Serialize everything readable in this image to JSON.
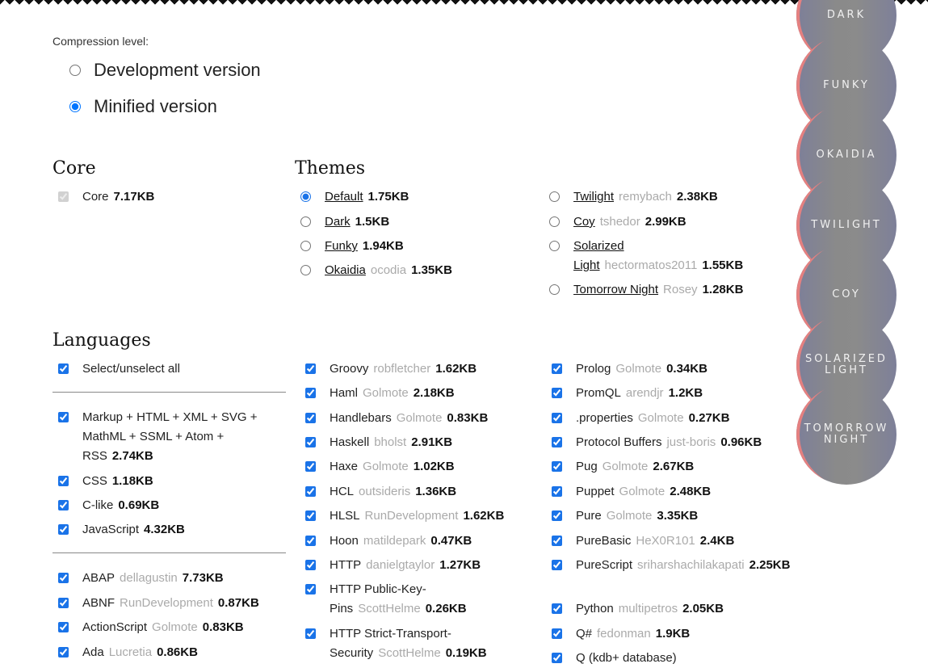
{
  "compression": {
    "label": "Compression level:",
    "options": [
      "Development version",
      "Minified version"
    ],
    "selected": "Minified version"
  },
  "core": {
    "heading": "Core",
    "item": {
      "name": "Core",
      "size": "7.17KB"
    }
  },
  "themes": {
    "heading": "Themes",
    "col1": [
      {
        "name": "Default",
        "owner": "",
        "size": "1.75KB"
      },
      {
        "name": "Dark",
        "owner": "",
        "size": "1.5KB"
      },
      {
        "name": "Funky",
        "owner": "",
        "size": "1.94KB"
      },
      {
        "name": "Okaidia",
        "owner": "ocodia",
        "size": "1.35KB"
      }
    ],
    "col2": [
      {
        "name": "Twilight",
        "owner": "remybach",
        "size": "2.38KB"
      },
      {
        "name": "Coy",
        "owner": "tshedor",
        "size": "2.99KB"
      },
      {
        "name": "Solarized Light",
        "owner": "hectormatos2011",
        "size": "1.55KB"
      },
      {
        "name": "Tomorrow Night",
        "owner": "Rosey",
        "size": "1.28KB"
      }
    ]
  },
  "languages": {
    "heading": "Languages",
    "select_all": "Select/unselect all",
    "col1": [
      {
        "name": "Markup + HTML + XML + SVG + MathML + SSML + Atom + RSS",
        "owner": "",
        "size": "2.74KB"
      },
      {
        "name": "CSS",
        "owner": "",
        "size": "1.18KB"
      },
      {
        "name": "C-like",
        "owner": "",
        "size": "0.69KB"
      },
      {
        "name": "JavaScript",
        "owner": "",
        "size": "4.32KB"
      },
      {
        "name": "ABAP",
        "owner": "dellagustin",
        "size": "7.73KB"
      },
      {
        "name": "ABNF",
        "owner": "RunDevelopment",
        "size": "0.87KB"
      },
      {
        "name": "ActionScript",
        "owner": "Golmote",
        "size": "0.83KB"
      },
      {
        "name": "Ada",
        "owner": "Lucretia",
        "size": "0.86KB"
      }
    ],
    "col2": [
      {
        "name": "Groovy",
        "owner": "robfletcher",
        "size": "1.62KB"
      },
      {
        "name": "Haml",
        "owner": "Golmote",
        "size": "2.18KB"
      },
      {
        "name": "Handlebars",
        "owner": "Golmote",
        "size": "0.83KB"
      },
      {
        "name": "Haskell",
        "owner": "bholst",
        "size": "2.91KB"
      },
      {
        "name": "Haxe",
        "owner": "Golmote",
        "size": "1.02KB"
      },
      {
        "name": "HCL",
        "owner": "outsideris",
        "size": "1.36KB"
      },
      {
        "name": "HLSL",
        "owner": "RunDevelopment",
        "size": "1.62KB"
      },
      {
        "name": "Hoon",
        "owner": "matildepark",
        "size": "0.47KB"
      },
      {
        "name": "HTTP",
        "owner": "danielgtaylor",
        "size": "1.27KB"
      },
      {
        "name": "HTTP Public-Key-Pins",
        "owner": "ScottHelme",
        "size": "0.26KB"
      },
      {
        "name": "HTTP Strict-Transport-Security",
        "owner": "ScottHelme",
        "size": "0.19KB"
      }
    ],
    "col3": [
      {
        "name": "Prolog",
        "owner": "Golmote",
        "size": "0.34KB"
      },
      {
        "name": "PromQL",
        "owner": "arendjr",
        "size": "1.2KB"
      },
      {
        "name": ".properties",
        "owner": "Golmote",
        "size": "0.27KB"
      },
      {
        "name": "Protocol Buffers",
        "owner": "just-boris",
        "size": "0.96KB"
      },
      {
        "name": "Pug",
        "owner": "Golmote",
        "size": "2.67KB"
      },
      {
        "name": "Puppet",
        "owner": "Golmote",
        "size": "2.48KB"
      },
      {
        "name": "Pure",
        "owner": "Golmote",
        "size": "3.35KB"
      },
      {
        "name": "PureBasic",
        "owner": "HeX0R101",
        "size": "2.4KB"
      },
      {
        "name": "PureScript",
        "owner": "sriharshachilakapati",
        "size": "2.25KB"
      },
      {
        "name": "Python",
        "owner": "multipetros",
        "size": "2.05KB"
      },
      {
        "name": "Q#",
        "owner": "fedonman",
        "size": "1.9KB"
      },
      {
        "name": "Q (kdb+ database)",
        "owner": "",
        "size": ""
      }
    ]
  },
  "theme_previews": [
    "DARK",
    "FUNKY",
    "OKAIDIA",
    "TWILIGHT",
    "COY",
    "SOLARIZED LIGHT",
    "TOMORROW NIGHT"
  ],
  "colors": {
    "accent": "#1a73e8",
    "owner_text": "#aaaaaa"
  }
}
